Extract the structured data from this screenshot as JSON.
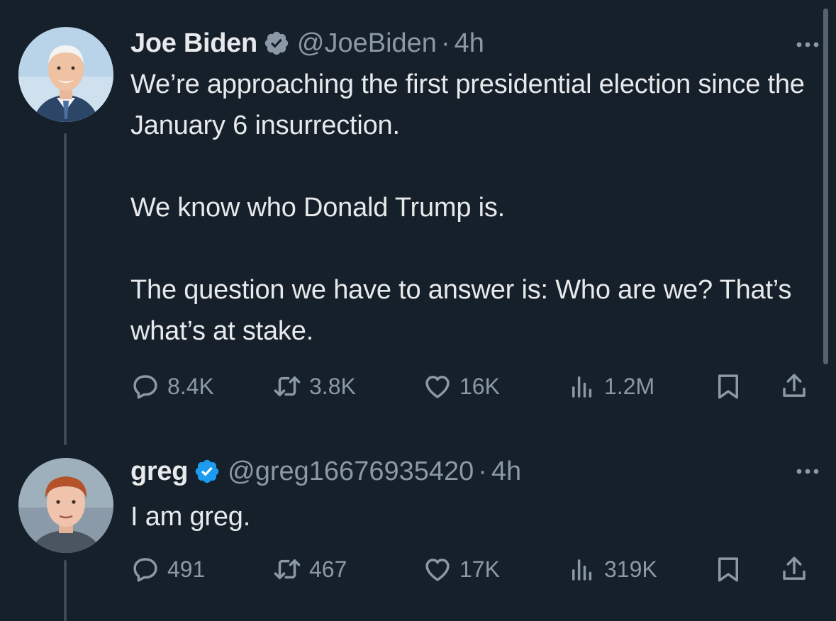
{
  "tweets": [
    {
      "author_name": "Joe Biden",
      "handle": "@JoeBiden",
      "separator": "·",
      "time": "4h",
      "verified_color": "#8b98a5",
      "paragraphs": [
        "We’re approaching the first presidential election since the January 6 insurrection.",
        "We know who Donald Trump is.",
        "The question we have to answer is: Who are we? That’s what’s at stake."
      ],
      "replies": "8.4K",
      "retweets": "3.8K",
      "likes": "16K",
      "views": "1.2M"
    },
    {
      "author_name": "greg",
      "handle": "@greg16676935420",
      "separator": "·",
      "time": "4h",
      "verified_color": "#1d9bf0",
      "paragraphs": [
        "I am greg."
      ],
      "replies": "491",
      "retweets": "467",
      "likes": "17K",
      "views": "319K"
    }
  ],
  "icons": {
    "reply": "reply-icon",
    "retweet": "retweet-icon",
    "like": "heart-icon",
    "views": "views-icon",
    "bookmark": "bookmark-icon",
    "share": "share-icon",
    "more": "more-icon",
    "verified": "verified-badge-icon"
  },
  "colors": {
    "background": "#15202b",
    "text": "#e7e9ea",
    "muted": "#8b98a5",
    "blue_check": "#1d9bf0"
  }
}
